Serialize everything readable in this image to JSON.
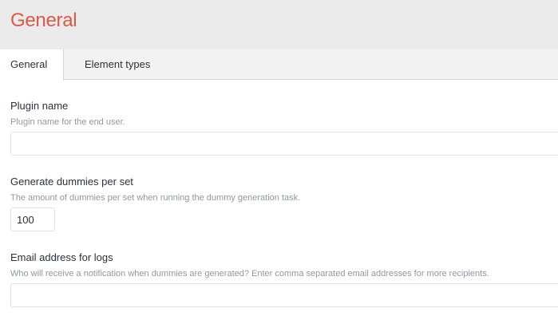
{
  "header": {
    "title": "General"
  },
  "tabs": [
    {
      "label": "General",
      "active": true
    },
    {
      "label": "Element types",
      "active": false
    }
  ],
  "fields": {
    "plugin_name": {
      "label": "Plugin name",
      "hint": "Plugin name for the end user.",
      "value": "",
      "placeholder": ""
    },
    "dummies_per_set": {
      "label": "Generate dummies per set",
      "hint": "The amount of dummies per set when running the dummy generation task.",
      "value": "100"
    },
    "email_logs": {
      "label": "Email address for logs",
      "hint": "Who will receive a notification when dummies are generated? Enter comma separated email addresses for more recipients.",
      "value": "",
      "placeholder": ""
    }
  },
  "colors": {
    "title_accent": "#da5a47",
    "header_bg": "#ebebeb",
    "tabbar_bg": "#f3f3f3",
    "hint_text": "#8f98a3"
  }
}
